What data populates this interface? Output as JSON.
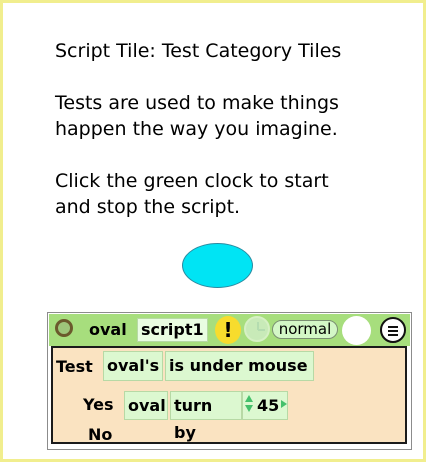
{
  "page": {
    "title": "Script Tile: Test Category Tiles",
    "paragraph1_line1": "Tests are used to make things",
    "paragraph1_line2": "happen the way you imagine.",
    "paragraph2_line1": "Click the green clock to start",
    "paragraph2_line2": "and stop the script."
  },
  "script": {
    "object_name": "oval",
    "script_name": "script1",
    "warning_symbol": "!",
    "status": "normal",
    "icons": [
      "stop-circle-icon",
      "warning-icon",
      "clock-icon",
      "menu-icon"
    ],
    "colors": {
      "header": "#a7de7d",
      "body": "#fae3c1",
      "tile": "#dcf8d0",
      "warning": "#f7dc2d",
      "oval": "#00e4f4"
    },
    "test": {
      "label": "Test",
      "subject": "oval's",
      "condition": "is under mouse"
    },
    "yes": {
      "label": "Yes",
      "object": "oval",
      "action": "turn by",
      "value": "45"
    },
    "no": {
      "label": "No"
    }
  }
}
